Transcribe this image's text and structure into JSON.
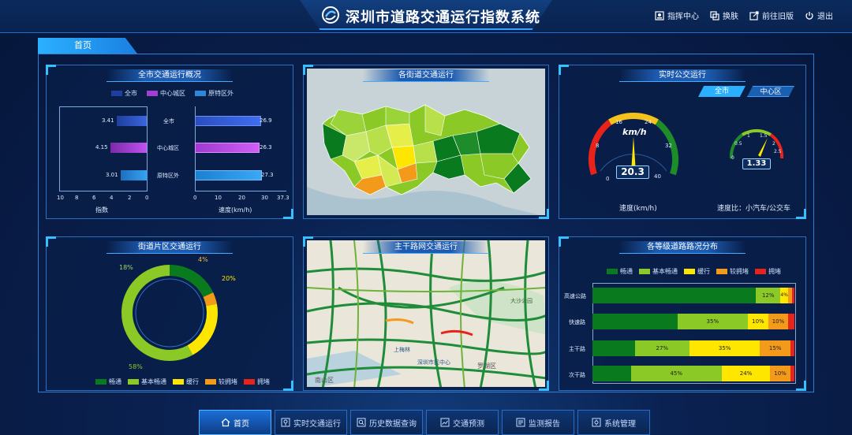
{
  "header": {
    "title": "深圳市道路交通运行指数系统",
    "actions": [
      {
        "label": "指挥中心",
        "icon": "command-center-icon"
      },
      {
        "label": "换肤",
        "icon": "skin-icon"
      },
      {
        "label": "前往旧版",
        "icon": "old-version-icon"
      },
      {
        "label": "退出",
        "icon": "power-icon"
      }
    ]
  },
  "home_tab": "首页",
  "panels": {
    "overview": {
      "title": "全市交通运行概况",
      "legend": [
        "全市",
        "中心城区",
        "原特区外"
      ],
      "legend_colors": [
        "#1f3f9e",
        "#a23fd1",
        "#2c87d9"
      ],
      "left_values": [
        "3.41",
        "4.15",
        "3.01"
      ],
      "right_values": [
        "26.9",
        "26.3",
        "27.3"
      ],
      "categories": [
        "全市",
        "中心城区",
        "原特区外"
      ],
      "left_axis_ticks": [
        "10",
        "8",
        "6",
        "4",
        "2",
        "0"
      ],
      "right_axis_ticks": [
        "0",
        "10",
        "20",
        "30",
        "37.3"
      ],
      "left_axis_label": "指数",
      "right_axis_label": "速度(km/h)"
    },
    "street_map": {
      "title": "各街道交通运行"
    },
    "bus": {
      "title": "实时公交运行",
      "tab_city": "全市",
      "tab_center": "中心区",
      "speed_value": "20.3",
      "speed_unit": "km/h",
      "speed_ticks": [
        "0",
        "8",
        "16",
        "24",
        "32",
        "40"
      ],
      "speed_label": "速度(km/h)",
      "ratio_value": "1.33",
      "ratio_ticks": [
        "0",
        "0.5",
        "1",
        "1.5",
        "2",
        "2.5"
      ],
      "ratio_label": "速度比：小汽车/公交车"
    },
    "district": {
      "title": "街道片区交通运行",
      "percent_labels": [
        "18%",
        "4%",
        "20%",
        "58%"
      ],
      "legend": [
        "畅通",
        "基本畅通",
        "缓行",
        "较拥堵",
        "拥堵"
      ]
    },
    "arterial_map": {
      "title": "主干路网交通运行",
      "labels": [
        "上梅林",
        "深圳市民中心",
        "南山区",
        "罗湖区",
        "大沙公园"
      ]
    },
    "road_levels": {
      "title": "各等级道路路况分布",
      "legend": [
        "畅通",
        "基本畅通",
        "缓行",
        "较拥堵",
        "拥堵"
      ],
      "rows": [
        {
          "name": "高速公路",
          "labels": [
            "",
            "12%",
            "4%",
            ""
          ]
        },
        {
          "name": "快速路",
          "labels": [
            "",
            "35%",
            "10%",
            "10%"
          ]
        },
        {
          "name": "主干路",
          "labels": [
            "",
            "27%",
            "35%",
            "15%"
          ]
        },
        {
          "name": "次干路",
          "labels": [
            "",
            "45%",
            "24%",
            "10%"
          ]
        }
      ]
    }
  },
  "colors": {
    "smooth": "#0a7a1f",
    "basic_smooth": "#8ac926",
    "slow": "#ffe600",
    "congested_light": "#f39a1b",
    "congested": "#e8231c"
  },
  "bottom_nav": [
    {
      "label": "首页",
      "icon": "home-icon"
    },
    {
      "label": "实时交通运行",
      "icon": "location-icon"
    },
    {
      "label": "历史数据查询",
      "icon": "search-icon"
    },
    {
      "label": "交通预测",
      "icon": "chart-icon"
    },
    {
      "label": "监测报告",
      "icon": "report-icon"
    },
    {
      "label": "系统管理",
      "icon": "settings-icon"
    }
  ]
}
